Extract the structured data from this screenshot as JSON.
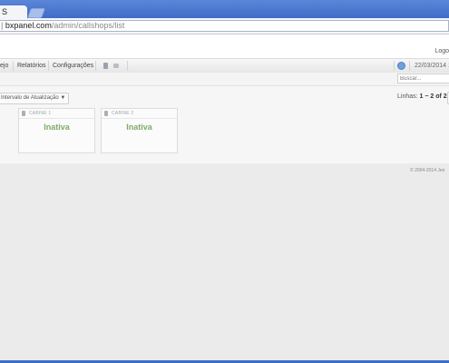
{
  "browser": {
    "tab_title": "S",
    "url_prefix": "|",
    "url_host": "bxpanel.com",
    "url_path": "/admin/callshops/list"
  },
  "header": {
    "logout_label": "Logo"
  },
  "nav": {
    "items": [
      "ejo",
      "Relatórios",
      "Configurações"
    ],
    "date": "22/03/2014 1"
  },
  "search": {
    "placeholder": "Buscar..."
  },
  "toolbar": {
    "interval_label": "Intervalo de Atualização",
    "interval_caret": "▼",
    "pager_prefix": "Linhas:",
    "pager_range": "1 − 2 of 2"
  },
  "booths": [
    {
      "name": "CABINE 1",
      "status": "Inativa"
    },
    {
      "name": "CABINE 2",
      "status": "Inativa"
    }
  ],
  "footer": {
    "copyright": "© 2004-2014 Jen"
  },
  "colors": {
    "status_inactive": "#7cac67",
    "browser_frame": "#3f6cc7"
  }
}
